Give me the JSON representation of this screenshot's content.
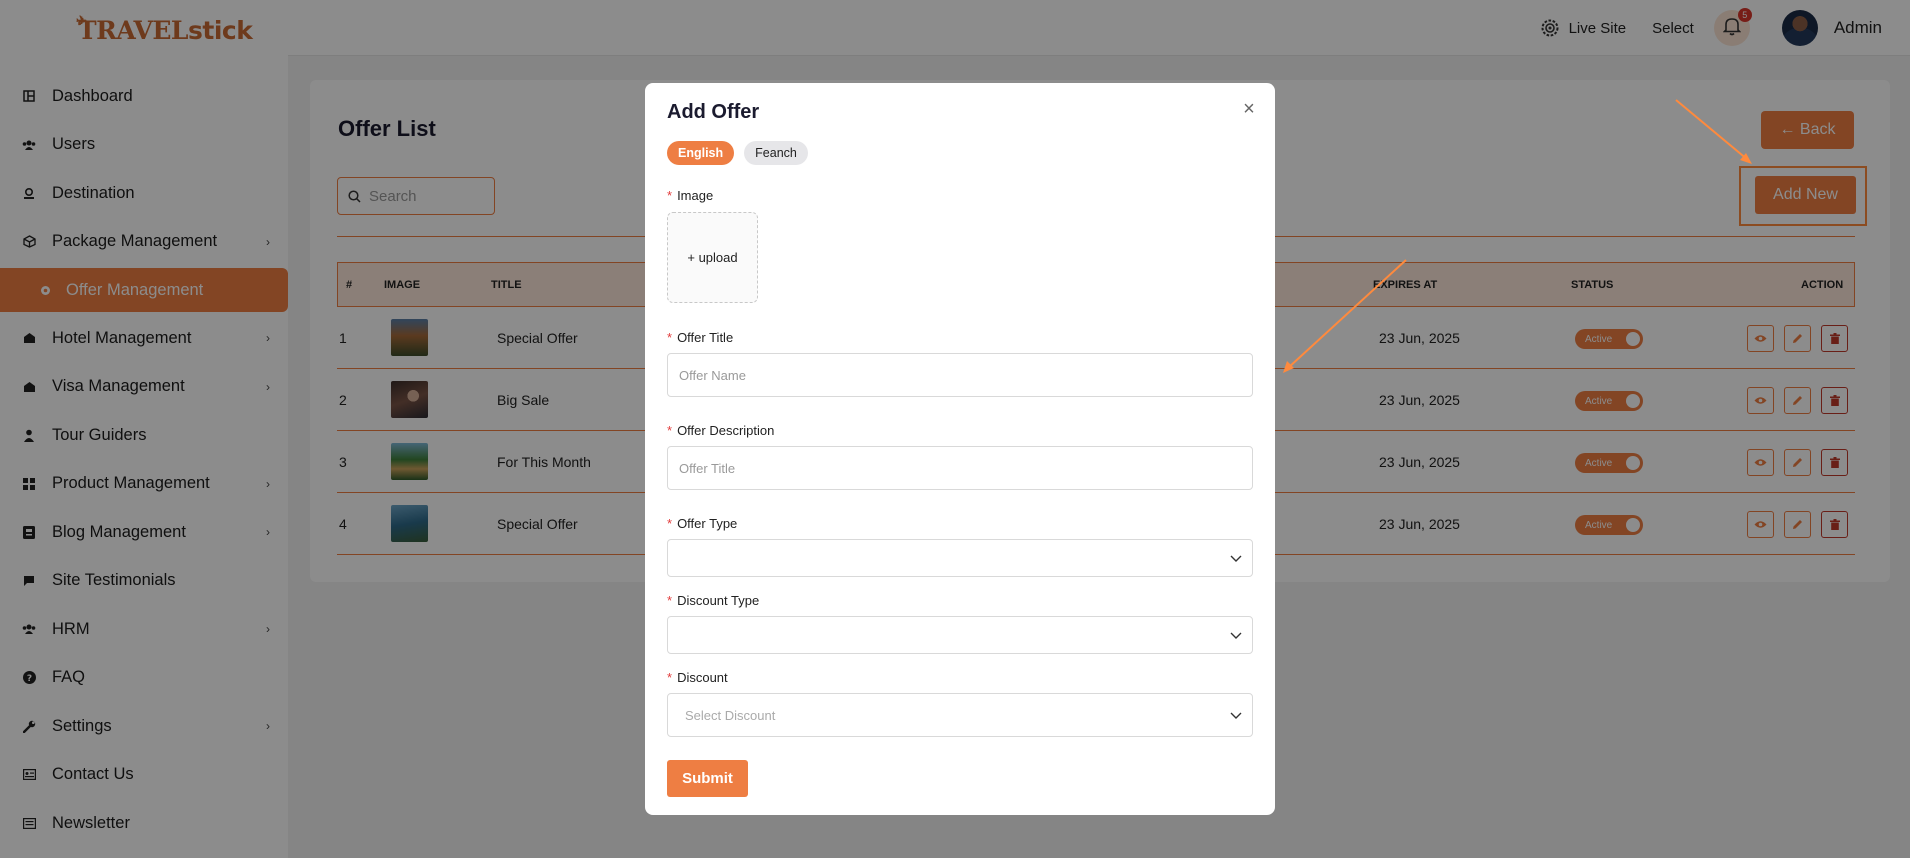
{
  "brand": {
    "logo_part1": "TRAVEL",
    "logo_part2": "stick"
  },
  "header": {
    "live_site": "Live Site",
    "language_select": "Select",
    "notification_count": "5",
    "user_name": "Admin"
  },
  "sidebar": {
    "items": [
      {
        "label": "Dashboard",
        "icon": "dashboard-icon",
        "has_children": false
      },
      {
        "label": "Users",
        "icon": "users-icon",
        "has_children": false
      },
      {
        "label": "Destination",
        "icon": "destination-icon",
        "has_children": false
      },
      {
        "label": "Package Management",
        "icon": "package-icon",
        "has_children": true
      },
      {
        "label": "Offer Management",
        "icon": "offer-icon",
        "has_children": false,
        "active": true
      },
      {
        "label": "Hotel Management",
        "icon": "hotel-icon",
        "has_children": true
      },
      {
        "label": "Visa Management",
        "icon": "visa-icon",
        "has_children": true
      },
      {
        "label": "Tour Guiders",
        "icon": "guide-icon",
        "has_children": false
      },
      {
        "label": "Product Management",
        "icon": "product-icon",
        "has_children": true
      },
      {
        "label": "Blog Management",
        "icon": "blog-icon",
        "has_children": true
      },
      {
        "label": "Site Testimonials",
        "icon": "testimonial-icon",
        "has_children": false
      },
      {
        "label": "HRM",
        "icon": "hrm-icon",
        "has_children": true
      },
      {
        "label": "FAQ",
        "icon": "faq-icon",
        "has_children": false
      },
      {
        "label": "Settings",
        "icon": "wrench-icon",
        "has_children": true
      },
      {
        "label": "Contact Us",
        "icon": "contact-icon",
        "has_children": false
      },
      {
        "label": "Newsletter",
        "icon": "newsletter-icon",
        "has_children": false
      }
    ]
  },
  "page": {
    "title": "Offer List",
    "back_label": "← Back",
    "add_new_label": "Add New",
    "search_placeholder": "Search"
  },
  "table": {
    "columns": [
      "#",
      "IMAGE",
      "TITLE",
      "EXPIRES AT",
      "STATUS",
      "ACTION"
    ],
    "rows": [
      {
        "num": "1",
        "title": "Special Offer",
        "expires": "23 Jun, 2025",
        "status": "Active"
      },
      {
        "num": "2",
        "title": "Big Sale",
        "expires": "23 Jun, 2025",
        "status": "Active"
      },
      {
        "num": "3",
        "title": "For This Month",
        "expires": "23 Jun, 2025",
        "status": "Active"
      },
      {
        "num": "4",
        "title": "Special Offer",
        "expires": "23 Jun, 2025",
        "status": "Active"
      }
    ]
  },
  "modal": {
    "title": "Add Offer",
    "languages": [
      "English",
      "Feanch"
    ],
    "image_label": "Image",
    "upload_label": "+ upload",
    "offer_title_label": "Offer Title",
    "offer_title_placeholder": "Offer Name",
    "offer_description_label": "Offer Description",
    "offer_description_placeholder": "Offer Title",
    "offer_type_label": "Offer Type",
    "discount_type_label": "Discount Type",
    "discount_label": "Discount",
    "discount_placeholder": "Select Discount",
    "submit_label": "Submit"
  },
  "colors": {
    "accent": "#ee7e43",
    "required": "#e23b3b",
    "annotation": "#ff8a3d"
  }
}
